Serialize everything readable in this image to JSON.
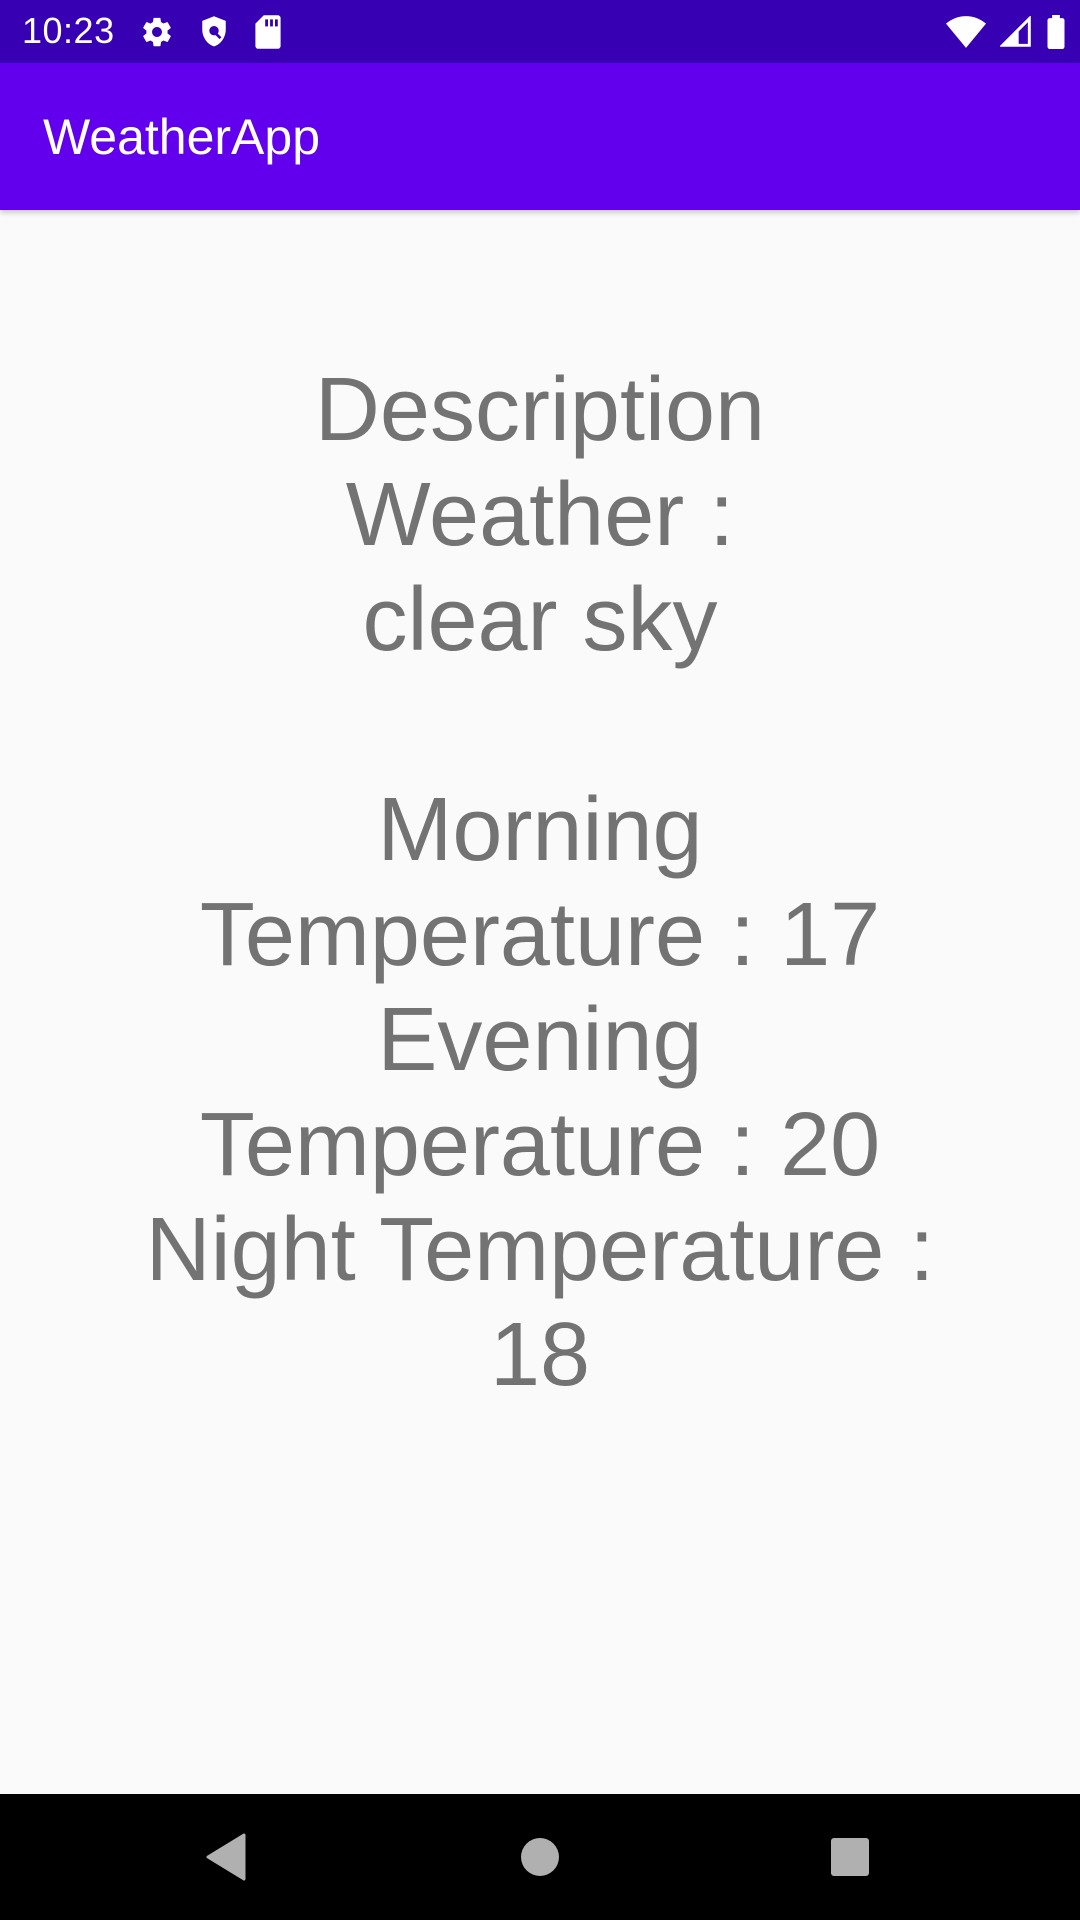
{
  "status_bar": {
    "time": "10:23",
    "left_icons": [
      "gear-icon",
      "shield-icon",
      "sd-card-icon"
    ],
    "right_icons": [
      "wifi-icon",
      "signal-icon",
      "battery-icon"
    ],
    "background": "#3700b3"
  },
  "app_bar": {
    "title": "WeatherApp",
    "background": "#6200ee"
  },
  "weather": {
    "description_lines": [
      "Description",
      "Weather :",
      "clear sky"
    ],
    "temperature_lines": [
      "Morning",
      "Temperature : 17",
      "Evening",
      "Temperature : 20",
      "Night Temperature :",
      "18"
    ],
    "text_color": "#737373"
  },
  "nav_bar": {
    "buttons": [
      "back-icon",
      "home-icon",
      "recents-icon"
    ],
    "background": "#000000"
  }
}
